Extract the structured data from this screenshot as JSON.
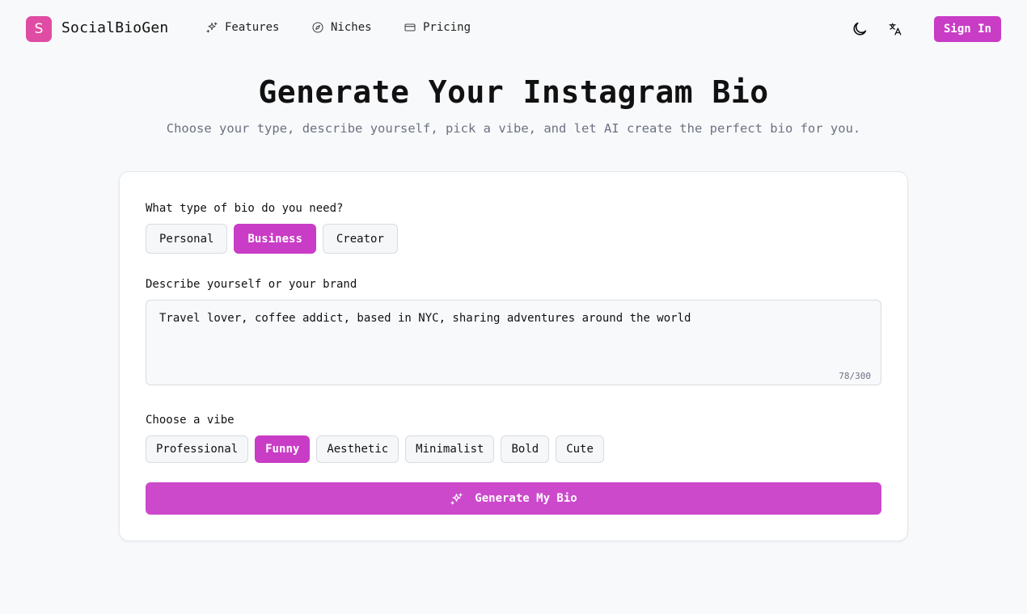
{
  "nav": {
    "logo_letter": "S",
    "brand": "SocialBioGen",
    "links": [
      {
        "label": "Features",
        "icon": "sparkles-icon"
      },
      {
        "label": "Niches",
        "icon": "compass-icon"
      },
      {
        "label": "Pricing",
        "icon": "credit-card-icon"
      }
    ],
    "theme_icon": "moon-icon",
    "language_icon": "translate-icon",
    "signin_label": "Sign In"
  },
  "hero": {
    "title": "Generate Your Instagram Bio",
    "subtitle": "Choose your type, describe yourself, pick a vibe, and let AI create the perfect bio for you."
  },
  "form": {
    "type_label": "What type of bio do you need?",
    "types": [
      "Personal",
      "Business",
      "Creator"
    ],
    "selected_type": "Business",
    "describe_label": "Describe yourself or your brand",
    "description": "Travel lover, coffee addict, based in NYC, sharing adventures around the world",
    "char_count": "78/300",
    "vibe_label": "Choose a vibe",
    "vibes": [
      "Professional",
      "Funny",
      "Aesthetic",
      "Minimalist",
      "Bold",
      "Cute"
    ],
    "selected_vibe": "Funny",
    "generate_label": "Generate My Bio"
  },
  "colors": {
    "accent": "#c93cc6",
    "logo": "#e04ca3",
    "background": "#f8f9fb"
  }
}
